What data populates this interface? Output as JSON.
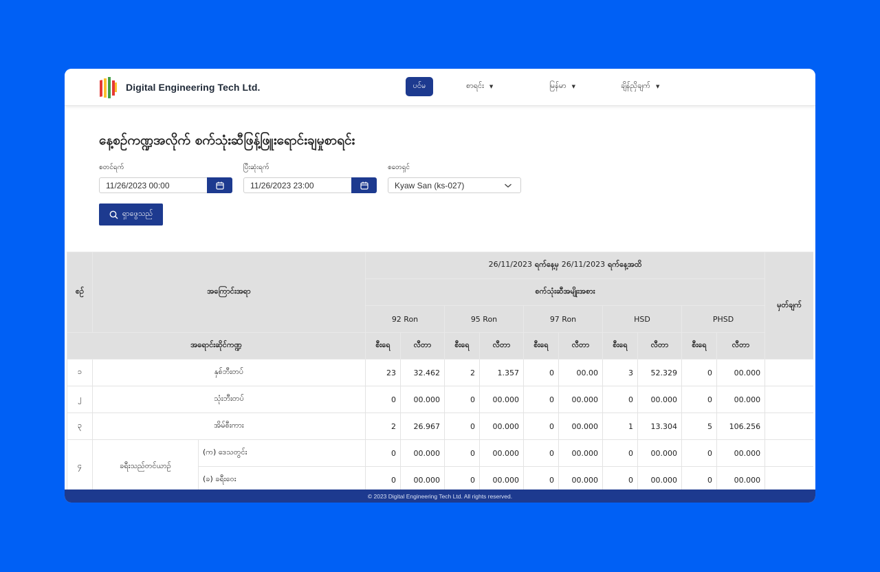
{
  "header": {
    "brand": "Digital Engineering Tech Ltd.",
    "nav": {
      "home": "ပင်မ",
      "lists": "စာရင်း",
      "language": "မြန်မာ",
      "settings": "ချိန်ညှိချက်"
    }
  },
  "page": {
    "title": "နေ့စဉ်ကဏ္ဍအလိုက် စက်သုံးဆီဖြန့်ဖြူးရောင်းချမှုစာရင်း"
  },
  "filters": {
    "start_label": "စတင်ရက်",
    "start_value": "11/26/2023 00:00",
    "end_label": "ပြီးဆုံးရက်",
    "end_value": "11/26/2023 23:00",
    "cashier_label": "စတေရှင်",
    "cashier_value": "Kyaw San (ks-027)",
    "search_label": "ရှာဖွေသည်"
  },
  "table": {
    "col_no": "စဉ်",
    "col_desc": "အကြောင်းအရာ",
    "date_range": {
      "from": "26/11/2023",
      "from_suffix": "ရက်နေ့မှ",
      "to": "26/11/2023",
      "to_suffix": "ရက်နေ့အထိ"
    },
    "fuel_type_header": "စက်သုံးဆီအမျိုးအစား",
    "col_remark": "မှတ်ချက်",
    "sales_category": "အရောင်းဆိုင်ကဏ္ဍ",
    "fuels": [
      "92 Ron",
      "95 Ron",
      "97 Ron",
      "HSD",
      "PHSD"
    ],
    "sub_count": "စီးရေ",
    "sub_liter": "လီတာ",
    "rows": [
      {
        "no": "၁",
        "label": "နှစ်ဘီးတပ်",
        "vals": [
          "23",
          "32.462",
          "2",
          "1.357",
          "0",
          "00.00",
          "3",
          "52.329",
          "0",
          "00.000"
        ]
      },
      {
        "no": "၂",
        "label": "သုံးဘီးတပ်",
        "vals": [
          "0",
          "00.000",
          "0",
          "00.000",
          "0",
          "00.000",
          "0",
          "00.000",
          "0",
          "00.000"
        ]
      },
      {
        "no": "၃",
        "label": "အိမ်စီးကား",
        "vals": [
          "2",
          "26.967",
          "0",
          "00.000",
          "0",
          "00.000",
          "1",
          "13.304",
          "5",
          "106.256"
        ]
      }
    ],
    "group_row": {
      "no": "၄",
      "label": "ခရီးသည်တင်ယာဉ်",
      "subs": [
        {
          "label": "(က) ဒေသတွင်း",
          "vals": [
            "0",
            "00.000",
            "0",
            "00.000",
            "0",
            "00.000",
            "0",
            "00.000",
            "0",
            "00.000"
          ]
        },
        {
          "label": "(ခ) ခရီးဝေး",
          "vals": [
            "0",
            "00.000",
            "0",
            "00.000",
            "0",
            "00.000",
            "0",
            "00.000",
            "0",
            "00.000"
          ]
        }
      ]
    }
  },
  "footer": {
    "text": "© 2023 Digital Engineering Tech Ltd. All rights reserved."
  },
  "colors": {
    "background": "#0060F5",
    "primary": "#1D3A8F",
    "table_header": "#E0E0E0"
  }
}
